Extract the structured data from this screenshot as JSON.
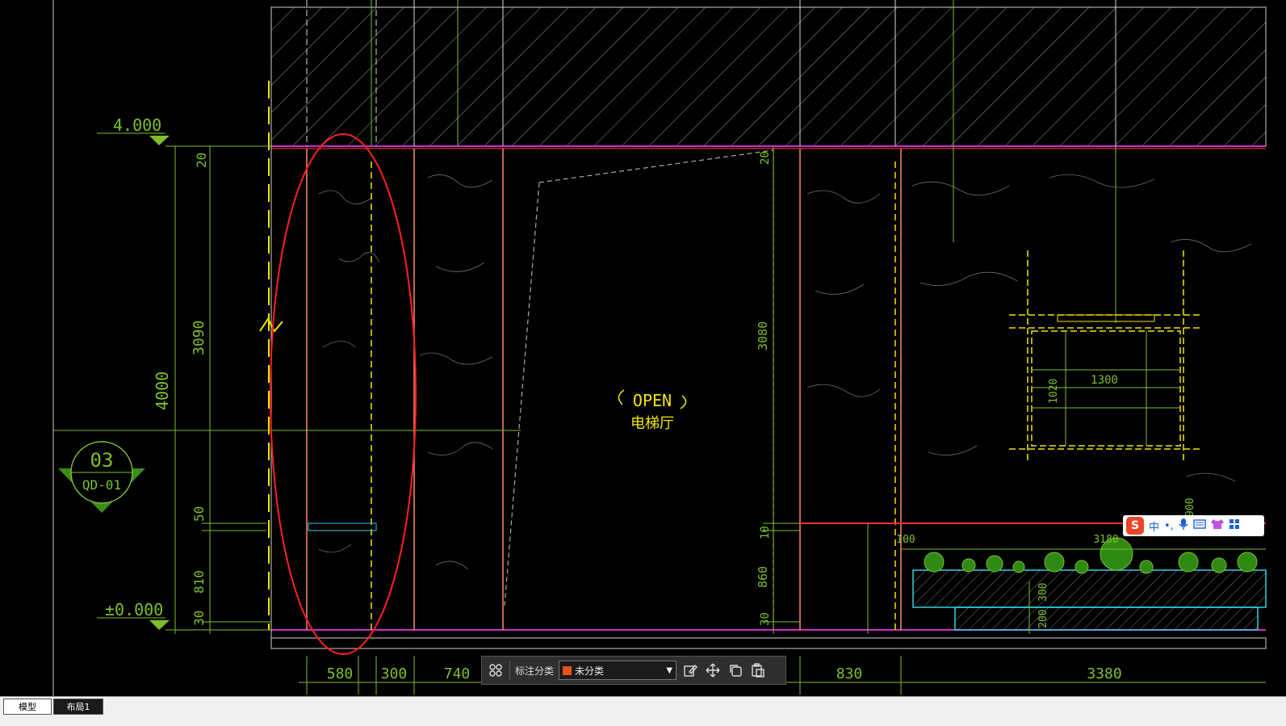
{
  "drawing": {
    "levels": [
      "4.000",
      "±0.000"
    ],
    "left_dims": [
      "20",
      "3090",
      "4000",
      "50",
      "810",
      "30"
    ],
    "bubble": {
      "number": "03",
      "code": "QD-01"
    },
    "center_dims": [
      "20",
      "3080",
      "10",
      "860",
      "30"
    ],
    "door_label": {
      "line1": "OPEN",
      "line2": "电梯厅"
    },
    "window_dims": [
      "1300",
      "1020"
    ],
    "planter_dims": [
      "100",
      "3180",
      "300",
      "200"
    ],
    "side_dim": "900",
    "bottom_dims": [
      "580",
      "300",
      "740",
      "830",
      "3380"
    ]
  },
  "toolbar": {
    "label": "标注分类",
    "selected_category": "未分类",
    "selected_color": "#e8501c"
  },
  "ime": {
    "mode": "中",
    "punct": "•,",
    "logo": "S"
  },
  "tabs": [
    {
      "label": "模型"
    },
    {
      "label": "布局1"
    }
  ]
}
